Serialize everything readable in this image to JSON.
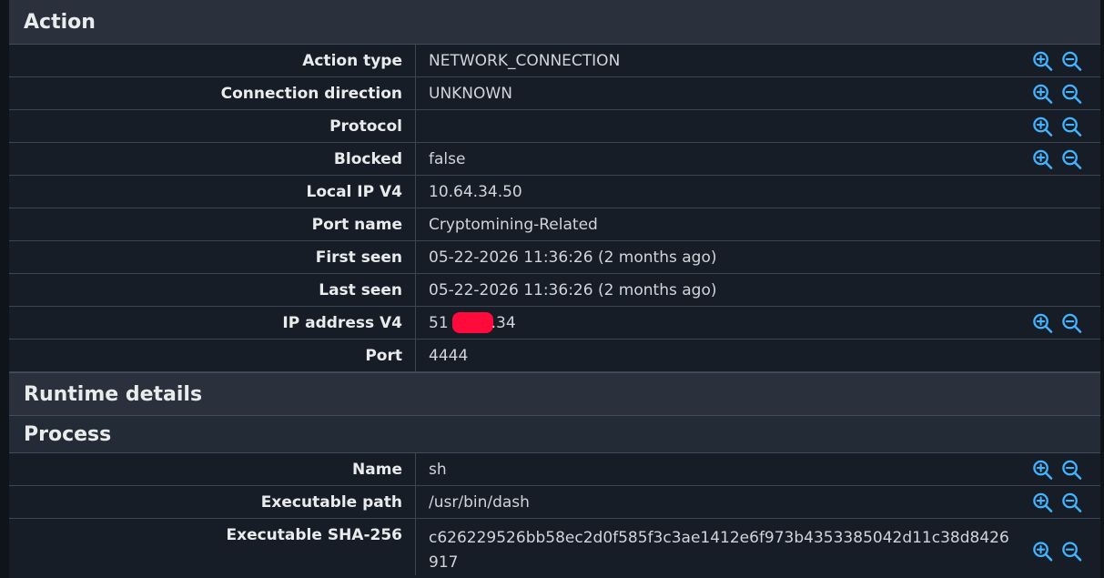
{
  "action": {
    "title": "Action",
    "rows": [
      {
        "key": "Action type",
        "value": "NETWORK_CONNECTION"
      },
      {
        "key": "Connection direction",
        "value": "UNKNOWN"
      },
      {
        "key": "Protocol",
        "value": ""
      },
      {
        "key": "Blocked",
        "value": "false"
      },
      {
        "key": "Local IP V4",
        "value": "10.64.34.50"
      },
      {
        "key": "Port name",
        "value": "Cryptomining-Related"
      },
      {
        "key": "First seen",
        "value": "05-22-2026 11:36:26 (2 months ago)"
      },
      {
        "key": "Last seen",
        "value": "05-22-2026 11:36:26 (2 months ago)"
      },
      {
        "key": "IP address V4",
        "value_prefix": "51",
        "value_suffix": ".34"
      },
      {
        "key": "Port",
        "value": "4444"
      }
    ]
  },
  "runtime": {
    "title": "Runtime details",
    "process": {
      "title": "Process",
      "rows": [
        {
          "key": "Name",
          "value": "sh"
        },
        {
          "key": "Executable path",
          "value": "/usr/bin/dash"
        },
        {
          "key": "Executable SHA-256",
          "value": "c626229526bb58ec2d0f585f3c3ae1412e6f973b4353385042d11c38d8426917"
        }
      ]
    }
  },
  "icons": {
    "zoom_in": "zoom-in-icon",
    "zoom_out": "zoom-out-icon",
    "color": "#42b4ff"
  },
  "redaction_color": "#ff0a3a"
}
